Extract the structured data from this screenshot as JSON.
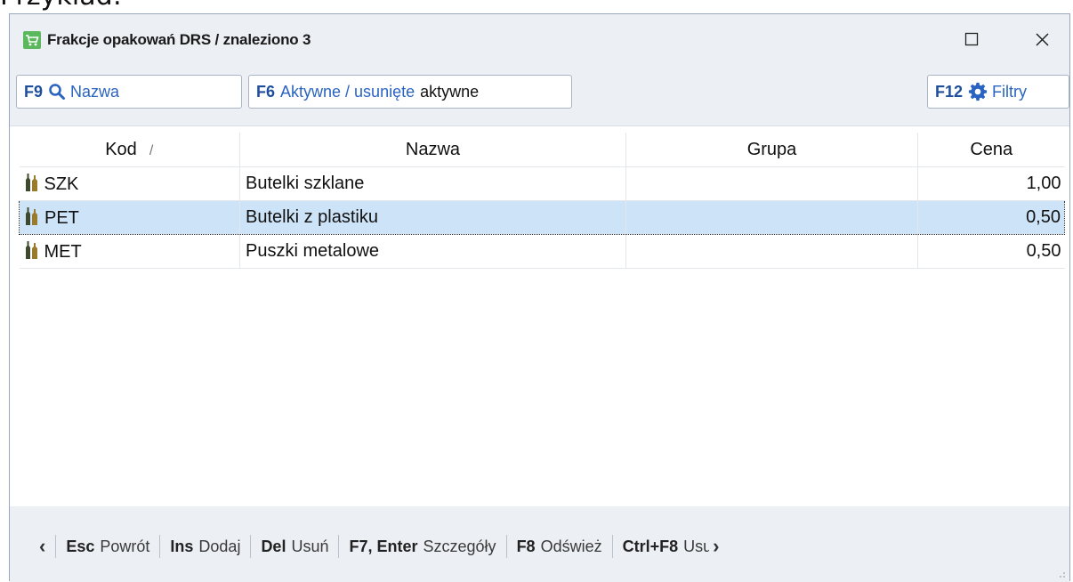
{
  "above_text": "Przykład:",
  "window": {
    "title": "Frakcje opakowań DRS / znaleziono 3"
  },
  "toolbar": {
    "search": {
      "key": "F9",
      "label": "Nazwa"
    },
    "active": {
      "key": "F6",
      "label": "Aktywne / usunięte",
      "value": "aktywne"
    },
    "filters": {
      "key": "F12",
      "label": "Filtry"
    }
  },
  "table": {
    "columns": [
      "Kod",
      "Nazwa",
      "Grupa",
      "Cena"
    ],
    "sort_indicator": "/",
    "rows": [
      {
        "kod": "SZK",
        "nazwa": "Butelki szklane",
        "grupa": "",
        "cena": "1,00"
      },
      {
        "kod": "PET",
        "nazwa": "Butelki z plastiku",
        "grupa": "",
        "cena": "0,50"
      },
      {
        "kod": "MET",
        "nazwa": "Puszki metalowe",
        "grupa": "",
        "cena": "0,50"
      }
    ],
    "selected_row": 1
  },
  "statusbar": {
    "items": [
      {
        "key": "Esc",
        "label": "Powrót"
      },
      {
        "key": "Ins",
        "label": "Dodaj"
      },
      {
        "key": "Del",
        "label": "Usuń"
      },
      {
        "key": "F7, Enter",
        "label": "Szczegóły"
      },
      {
        "key": "F8",
        "label": "Odśwież"
      },
      {
        "key": "Ctrl+F8",
        "label": "Usuń"
      }
    ]
  },
  "colors": {
    "accent_blue": "#2a64c2",
    "selection": "#cde3f7",
    "app_icon": "#5cb85c"
  }
}
